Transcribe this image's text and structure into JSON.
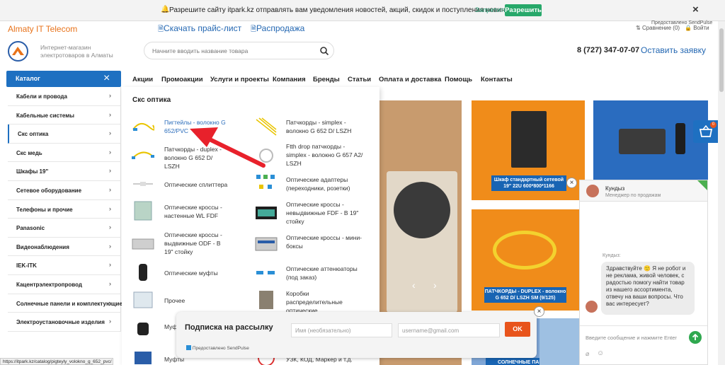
{
  "push": {
    "text": "Разрешите сайту itpark.kz отправлять вам уведомления новостей, акций, скидок и поступления новинок!",
    "deny": "Запретить",
    "allow": "Разрешить",
    "close": "×"
  },
  "top": {
    "brand": "Almaty IT Telecom",
    "price_link": "Скачать прайс-лист",
    "sale_link": "Распродажа",
    "sendpulse_note": "Предоставлено SendPulse",
    "compare": "Сравнение (0)",
    "login": "Войти"
  },
  "header": {
    "slogan": "Интернет-магазин электротоваров в Алматы",
    "search_placeholder": "Начните вводить название товара",
    "phone": "8 (727) 347-07-07",
    "leave_request": "Оставить заявку"
  },
  "catalog": {
    "button": "Каталог",
    "close": "×",
    "items": [
      {
        "label": "Кабели и провода"
      },
      {
        "label": "Кабельные системы"
      },
      {
        "label": "Скс оптика"
      },
      {
        "label": "Скс медь"
      },
      {
        "label": "Шкафы 19\""
      },
      {
        "label": "Сетевое оборудование"
      },
      {
        "label": "Телефоны и прочие"
      },
      {
        "label": "Panasonic"
      },
      {
        "label": "Видеонаблюдения"
      },
      {
        "label": "IEK-ITK"
      },
      {
        "label": "Кацентрэлектропровод"
      },
      {
        "label": "Солнечные панели и комплектующие"
      },
      {
        "label": "Электроустановочные изделия"
      }
    ],
    "chevron": "›"
  },
  "nav": [
    "Акции",
    "Промоакции",
    "Услуги и проекты",
    "Компания",
    "Бренды",
    "Статьи",
    "Оплата и доставка",
    "Помощь",
    "Контакты"
  ],
  "mega": {
    "title": "Скс оптика",
    "left": [
      "Пигтейлы - волокно G 652/PVC",
      "Патчкорды - duplex - волокно G 652 D/ LSZH",
      "Оптические сплиттера",
      "Оптические кроссы - настенные WL FDF",
      "Оптические кроссы - выдвижные ODF - В 19\" стойку",
      "Оптические муфты",
      "Прочее",
      "Муфты",
      "Муфты универсальные"
    ],
    "right": [
      "Патчкорды - simplex - волокно G 652 D/ LSZH",
      "Ftth drop патчкорды - simplex - волокно G 657 A2/ LSZH",
      "Оптические адаптеры (переходники, розетки)",
      "Оптические кроссы - невыдвижные FDF - В 19\" стойку",
      "Оптические кроссы - мини-боксы",
      "Оптические аттенюаторы (под заказ)",
      "Коробки распределительные оптические",
      "УЗК, КОД, Маркер и т.д."
    ]
  },
  "banners": {
    "cabinet_label": "Шкаф стандартный сетевой 19\" 22U 600*800*1166",
    "patch_label": "ПАТЧКОРДЫ - DUPLEX - волокно G 652 D/ LSZH SM (9/125)",
    "solar_label": "СОЛНЕЧНЫЕ ПАНЕЛИ"
  },
  "chat": {
    "agent_name": "Кундыз",
    "agent_role": "Менеджер по продажам",
    "sender": "Кундыз:",
    "message": "Здравствуйте 🙂 Я не робот и не реклама, живой человек, с радостью помогу найти товар из нашего ассортимента, отвечу на ваши вопросы. Что вас интересует?",
    "input_placeholder": "Введите сообщение и нажмите Enter"
  },
  "subscribe": {
    "title": "Подписка на рассылку",
    "name_placeholder": "Имя (необязательно)",
    "email_placeholder": "username@gmail.com",
    "ok": "OK",
    "powered": "Предоставлено SendPulse",
    "close": "×"
  },
  "cart_badge": "0",
  "status_url": "https://itpark.kz/catalog/pigteyly_volokno_g_652_pvc/",
  "colors": {
    "accent": "#1e70c1",
    "orange": "#e8731b",
    "link": "#2367b2",
    "banner_orange": "#f08c1a",
    "ok": "#e8541c"
  }
}
